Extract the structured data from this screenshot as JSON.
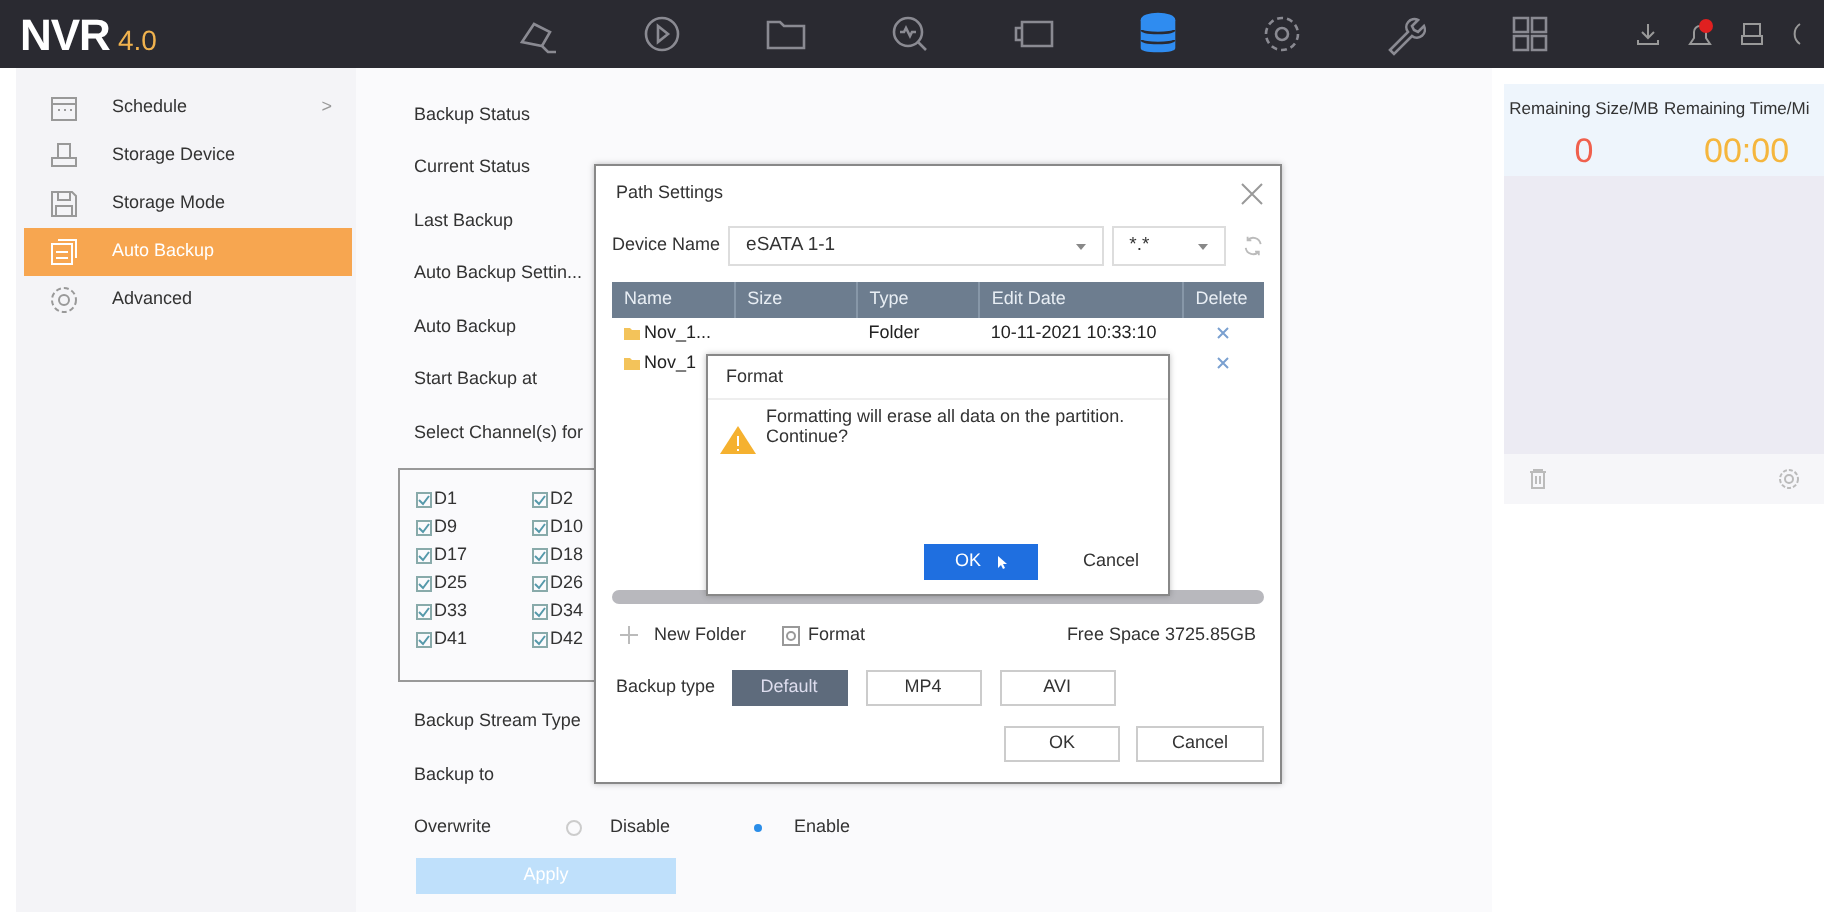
{
  "top_bar": {
    "logo": "NVR",
    "version": "4.0",
    "nav_icons": [
      {
        "kind": "camera",
        "selected": false
      },
      {
        "kind": "playback",
        "selected": false
      },
      {
        "kind": "folder",
        "selected": false
      },
      {
        "kind": "search",
        "selected": false
      },
      {
        "kind": "screen",
        "selected": false
      },
      {
        "kind": "storage",
        "selected": true
      },
      {
        "kind": "gear",
        "selected": false
      },
      {
        "kind": "wrench",
        "selected": false
      },
      {
        "kind": "grid",
        "selected": false
      }
    ]
  },
  "sidebar": {
    "items": [
      {
        "label": "Schedule",
        "kind": "calendar",
        "selected": false,
        "chevron": ">"
      },
      {
        "label": "Storage Device",
        "kind": "drive",
        "selected": false
      },
      {
        "label": "Storage Mode",
        "kind": "disk",
        "selected": false
      },
      {
        "label": "Auto Backup",
        "kind": "backup",
        "selected": true
      },
      {
        "label": "Advanced",
        "kind": "gear",
        "selected": false
      }
    ]
  },
  "backup_form": {
    "rows": [
      "Backup Status",
      "Current Status",
      "Last Backup",
      "Auto Backup Settin...",
      "Auto Backup",
      "Start Backup at",
      "Select Channel(s) for"
    ],
    "channels": [
      {
        "label": "D1",
        "checked": true
      },
      {
        "label": "D2",
        "checked": true
      },
      {
        "label": "D9",
        "checked": true
      },
      {
        "label": "D10",
        "checked": true
      },
      {
        "label": "D17",
        "checked": true
      },
      {
        "label": "D18",
        "checked": true
      },
      {
        "label": "D25",
        "checked": true
      },
      {
        "label": "D26",
        "checked": true
      },
      {
        "label": "D33",
        "checked": true
      },
      {
        "label": "D34",
        "checked": true
      },
      {
        "label": "D41",
        "checked": true
      },
      {
        "label": "D42",
        "checked": true
      }
    ],
    "stream_type_label": "Backup Stream Type",
    "backup_to_label": "Backup to",
    "overwrite_label": "Overwrite",
    "overwrite_options": [
      {
        "label": "Disable",
        "selected": false
      },
      {
        "label": "Enable",
        "selected": true
      }
    ],
    "apply_button": "Apply"
  },
  "right_panel": {
    "remaining_size_label": "Remaining Size/MB",
    "remaining_size": "0",
    "remaining_time_label": "Remaining Time/Mi",
    "remaining_time": "00:00"
  },
  "path_settings_dialog": {
    "title": "Path Settings",
    "device_label": "Device Name",
    "device": "eSATA 1-1",
    "filter": "*.*",
    "columns": [
      "Name",
      "Size",
      "Type",
      "Edit Date",
      "Delete"
    ],
    "rows": [
      {
        "name": "Nov_1...",
        "size": "",
        "type": "Folder",
        "edit_date": "10-11-2021 10:33:10"
      },
      {
        "name": "Nov_1",
        "size": "",
        "type": "",
        "edit_date": ""
      }
    ],
    "new_folder": "New Folder",
    "format": "Format",
    "free_space": "Free Space 3725.85GB",
    "backup_type_label": "Backup type",
    "backup_types": [
      {
        "label": "Default",
        "selected": true
      },
      {
        "label": "MP4",
        "selected": false
      },
      {
        "label": "AVI",
        "selected": false
      }
    ],
    "ok": "OK",
    "cancel": "Cancel"
  },
  "format_dialog": {
    "title": "Format",
    "message": "Formatting will erase all data on the partition. Continue?",
    "ok": "OK",
    "cancel": "Cancel"
  }
}
